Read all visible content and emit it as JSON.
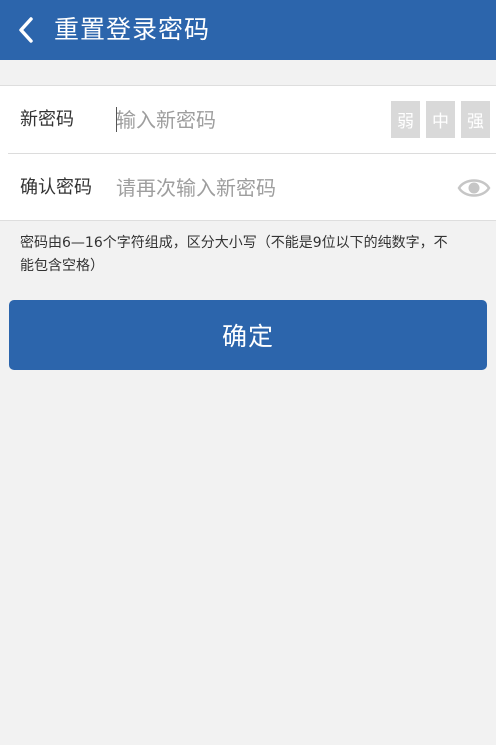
{
  "header": {
    "title": "重置登录密码",
    "back_icon": "chevron-left-icon"
  },
  "form": {
    "new_password": {
      "label": "新密码",
      "placeholder": "输入新密码",
      "value": ""
    },
    "strength": {
      "levels": [
        "弱",
        "中",
        "强"
      ]
    },
    "confirm_password": {
      "label": "确认密码",
      "placeholder": "请再次输入新密码",
      "value": "",
      "toggle_icon": "eye-icon"
    }
  },
  "hint": "密码由6—16个字符组成，区分大小写（不能是9位以下的纯数字，不能包含空格）",
  "confirm_button": "确定",
  "colors": {
    "primary": "#2c65ac",
    "background": "#f2f2f2",
    "strength_inactive": "#d9d9d9",
    "placeholder": "#9e9e9e"
  }
}
